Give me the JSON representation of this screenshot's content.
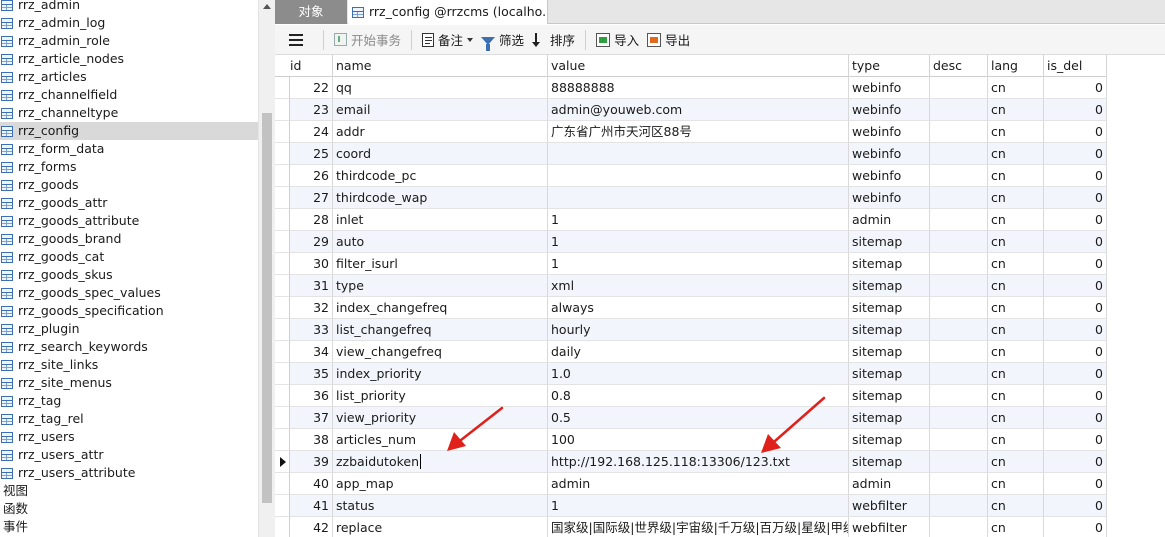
{
  "sidebar": {
    "tables": [
      "rrz_admin",
      "rrz_admin_log",
      "rrz_admin_role",
      "rrz_article_nodes",
      "rrz_articles",
      "rrz_channelfield",
      "rrz_channeltype",
      "rrz_config",
      "rrz_form_data",
      "rrz_forms",
      "rrz_goods",
      "rrz_goods_attr",
      "rrz_goods_attribute",
      "rrz_goods_brand",
      "rrz_goods_cat",
      "rrz_goods_skus",
      "rrz_goods_spec_values",
      "rrz_goods_specification",
      "rrz_plugin",
      "rrz_search_keywords",
      "rrz_site_links",
      "rrz_site_menus",
      "rrz_tag",
      "rrz_tag_rel",
      "rrz_users",
      "rrz_users_attr",
      "rrz_users_attribute"
    ],
    "selected": "rrz_config",
    "folders": [
      "视图",
      "函数",
      "事件"
    ]
  },
  "tabs": {
    "objects": "对象",
    "config": "rrz_config @rrzcms (localho..."
  },
  "toolbar": {
    "begin_transaction": "开始事务",
    "memo": "备注",
    "filter": "筛选",
    "sort": "排序",
    "import": "导入",
    "export": "导出"
  },
  "grid": {
    "columns": [
      "id",
      "name",
      "value",
      "type",
      "desc",
      "lang",
      "is_del"
    ],
    "current_row_id": 39,
    "rows": [
      {
        "id": "22",
        "name": "qq",
        "value": "88888888",
        "type": "webinfo",
        "desc": "",
        "lang": "cn",
        "is_del": "0"
      },
      {
        "id": "23",
        "name": "email",
        "value": "admin@youweb.com",
        "type": "webinfo",
        "desc": "",
        "lang": "cn",
        "is_del": "0"
      },
      {
        "id": "24",
        "name": "addr",
        "value": "广东省广州市天河区88号",
        "type": "webinfo",
        "desc": "",
        "lang": "cn",
        "is_del": "0"
      },
      {
        "id": "25",
        "name": "coord",
        "value": "",
        "type": "webinfo",
        "desc": "",
        "lang": "cn",
        "is_del": "0"
      },
      {
        "id": "26",
        "name": "thirdcode_pc",
        "value": "",
        "type": "webinfo",
        "desc": "",
        "lang": "cn",
        "is_del": "0"
      },
      {
        "id": "27",
        "name": "thirdcode_wap",
        "value": "",
        "type": "webinfo",
        "desc": "",
        "lang": "cn",
        "is_del": "0"
      },
      {
        "id": "28",
        "name": "inlet",
        "value": "1",
        "type": "admin",
        "desc": "",
        "lang": "cn",
        "is_del": "0"
      },
      {
        "id": "29",
        "name": "auto",
        "value": "1",
        "type": "sitemap",
        "desc": "",
        "lang": "cn",
        "is_del": "0"
      },
      {
        "id": "30",
        "name": "filter_isurl",
        "value": "1",
        "type": "sitemap",
        "desc": "",
        "lang": "cn",
        "is_del": "0"
      },
      {
        "id": "31",
        "name": "type",
        "value": "xml",
        "type": "sitemap",
        "desc": "",
        "lang": "cn",
        "is_del": "0"
      },
      {
        "id": "32",
        "name": "index_changefreq",
        "value": "always",
        "type": "sitemap",
        "desc": "",
        "lang": "cn",
        "is_del": "0"
      },
      {
        "id": "33",
        "name": "list_changefreq",
        "value": "hourly",
        "type": "sitemap",
        "desc": "",
        "lang": "cn",
        "is_del": "0"
      },
      {
        "id": "34",
        "name": "view_changefreq",
        "value": "daily",
        "type": "sitemap",
        "desc": "",
        "lang": "cn",
        "is_del": "0"
      },
      {
        "id": "35",
        "name": "index_priority",
        "value": "1.0",
        "type": "sitemap",
        "desc": "",
        "lang": "cn",
        "is_del": "0"
      },
      {
        "id": "36",
        "name": "list_priority",
        "value": "0.8",
        "type": "sitemap",
        "desc": "",
        "lang": "cn",
        "is_del": "0"
      },
      {
        "id": "37",
        "name": "view_priority",
        "value": "0.5",
        "type": "sitemap",
        "desc": "",
        "lang": "cn",
        "is_del": "0"
      },
      {
        "id": "38",
        "name": "articles_num",
        "value": "100",
        "type": "sitemap",
        "desc": "",
        "lang": "cn",
        "is_del": "0"
      },
      {
        "id": "39",
        "name": "zzbaidutoken",
        "value": "http://192.168.125.118:13306/123.txt",
        "type": "sitemap",
        "desc": "",
        "lang": "cn",
        "is_del": "0"
      },
      {
        "id": "40",
        "name": "app_map",
        "value": "admin",
        "type": "admin",
        "desc": "",
        "lang": "cn",
        "is_del": "0"
      },
      {
        "id": "41",
        "name": "status",
        "value": "1",
        "type": "webfilter",
        "desc": "",
        "lang": "cn",
        "is_del": "0"
      },
      {
        "id": "42",
        "name": "replace",
        "value": "国家级|国际级|世界级|宇宙级|千万级|百万级|星级|甲级|超",
        "type": "webfilter",
        "desc": "",
        "lang": "cn",
        "is_del": "0"
      }
    ]
  },
  "annotation_color": "#e0211b"
}
